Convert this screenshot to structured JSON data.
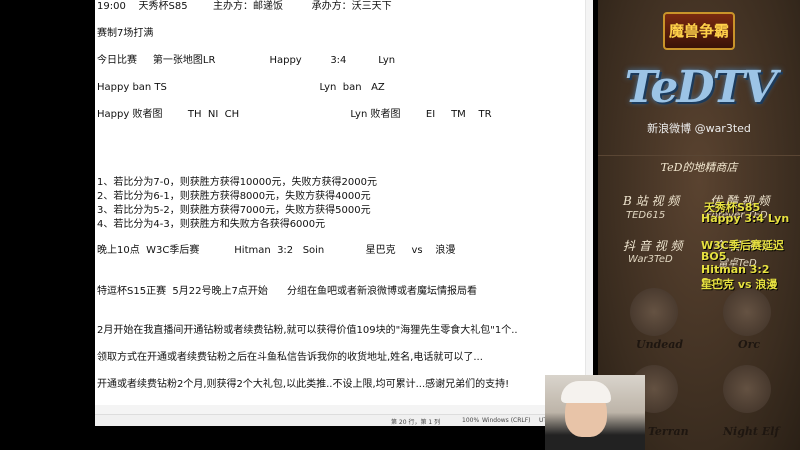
{
  "notepad": {
    "lines": [
      "19:00    天秀杯S85        主办方：邮递饭         承办方：沃三天下",
      "赛制7场打满",
      "今日比赛     第一张地图LR                 Happy         3:4          Lyn",
      "Happy ban TS                                                Lyn  ban   AZ",
      "Happy 败者图        TH  NI  CH                                   Lyn 败者图        EI     TM    TR",
      "1、若比分为7-0，则获胜方获得10000元，失败方获得2000元",
      "2、若比分为6-1，则获胜方获得8000元，失败方获得4000元",
      "3、若比分为5-2，则获胜方获得7000元，失败方获得5000元",
      "4、若比分为4-3，则获胜方和失败方各获得6000元",
      "晚上10点  W3C季后赛           Hitman  3:2   Soin             星巴克     vs    浪漫",
      "特逗杯S15正赛  5月22号晚上7点开始      分组在鱼吧或者新浪微博或者魔坛情报局看",
      "2月开始在我直播间开通钻粉或者续费钻粉,就可以获得价值109块的\"海狸先生零食大礼包\"1个..",
      "领取方式在开通或者续费钻粉之后在斗鱼私信告诉我你的收货地址,姓名,电话就可以了...",
      "开通或者续费钻粉2个月,则获得2个大礼包,以此类推..不设上限,均可累计...感谢兄弟们的支持!"
    ],
    "status": {
      "position": "第 20 行，第 1 列",
      "zoom": "100%",
      "eol": "Windows (CRLF)",
      "encoding": "UT"
    }
  },
  "panel": {
    "game_logo": "魔兽争霸",
    "brand": "TeDTV",
    "weibo": "新浪微博 @war3ted",
    "shop": "TeD的地精商店",
    "bilibili": {
      "label": "B 站 视 频",
      "id": "TED615"
    },
    "youku": {
      "label": "优 酷 视 频",
      "id": "Forever TED"
    },
    "douyin": {
      "label": "抖 音 视 频",
      "id": "War3TeD"
    },
    "toutiao": {
      "label": "今 日 头 条",
      "id": "雷卓TeD"
    },
    "races": [
      "Undead",
      "Orc",
      "Terran",
      "Night Elf"
    ]
  },
  "overlay": [
    "天秀杯S85",
    "Happy 3:4 Lyn",
    "W3C季后赛延迟",
    "BO5",
    "Hitman 3:2 Soin",
    "星巴克 vs 浪漫"
  ]
}
